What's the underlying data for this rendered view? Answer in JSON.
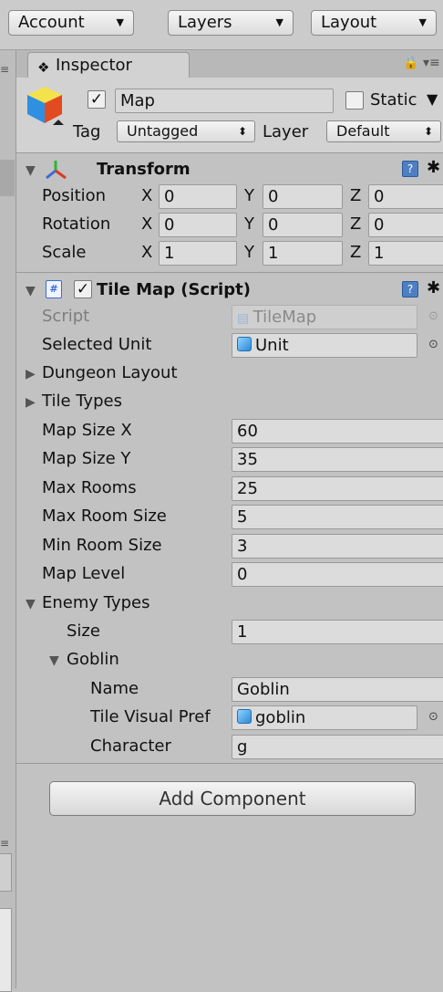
{
  "toolbar": {
    "account": "Account",
    "layers": "Layers",
    "layout": "Layout"
  },
  "tab": {
    "label": "Inspector"
  },
  "object": {
    "name": "Map",
    "static_label": "Static",
    "tag_label": "Tag",
    "tag_value": "Untagged",
    "layer_label": "Layer",
    "layer_value": "Default"
  },
  "transform": {
    "title": "Transform",
    "axis_x": "X",
    "axis_y": "Y",
    "axis_z": "Z",
    "rows": [
      {
        "label": "Position",
        "x": "0",
        "y": "0",
        "z": "0"
      },
      {
        "label": "Rotation",
        "x": "0",
        "y": "0",
        "z": "0"
      },
      {
        "label": "Scale",
        "x": "1",
        "y": "1",
        "z": "1"
      }
    ]
  },
  "tilemap": {
    "title": "Tile Map (Script)",
    "script_label": "Script",
    "script_value": "TileMap",
    "selected_unit_label": "Selected Unit",
    "selected_unit_value": "Unit",
    "dungeon_layout": "Dungeon Layout",
    "tile_types": "Tile Types",
    "fields": [
      {
        "label": "Map Size X",
        "value": "60"
      },
      {
        "label": "Map Size Y",
        "value": "35"
      },
      {
        "label": "Max Rooms",
        "value": "25"
      },
      {
        "label": "Max Room Size",
        "value": "5"
      },
      {
        "label": "Min Room Size",
        "value": "3"
      },
      {
        "label": "Map Level",
        "value": "0"
      }
    ],
    "enemy_types": "Enemy Types",
    "size_label": "Size",
    "size_value": "1",
    "goblin_label": "Goblin",
    "name_label": "Name",
    "name_value": "Goblin",
    "prefab_label": "Tile Visual Pref",
    "prefab_value": "goblin",
    "character_label": "Character",
    "character_value": "g"
  },
  "add_component": "Add Component"
}
